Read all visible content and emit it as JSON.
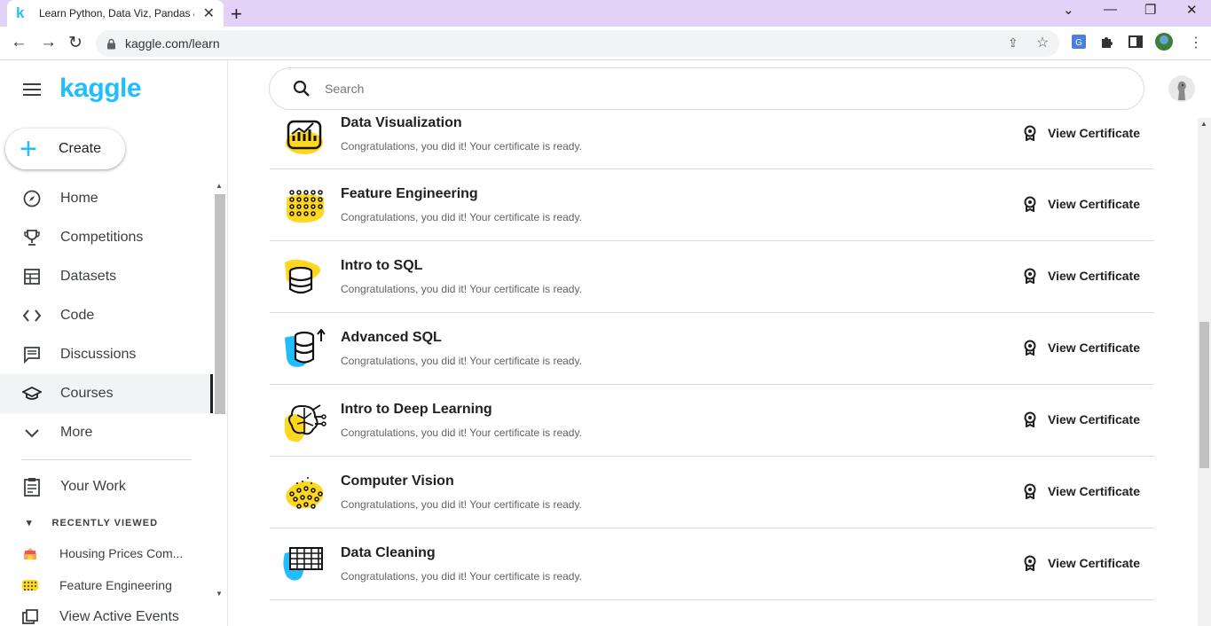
{
  "browser": {
    "tab_title": "Learn Python, Data Viz, Pandas &",
    "tab_favicon": "k",
    "url": "kaggle.com/learn"
  },
  "sidebar": {
    "logo": "kaggle",
    "create_label": "Create",
    "items": [
      {
        "label": "Home",
        "icon": "compass-icon"
      },
      {
        "label": "Competitions",
        "icon": "trophy-icon"
      },
      {
        "label": "Datasets",
        "icon": "table-icon"
      },
      {
        "label": "Code",
        "icon": "code-icon"
      },
      {
        "label": "Discussions",
        "icon": "comments-icon"
      },
      {
        "label": "Courses",
        "icon": "school-icon"
      },
      {
        "label": "More",
        "icon": "chevron-down-icon"
      }
    ],
    "your_work": "Your Work",
    "recently_viewed_header": "RECENTLY VIEWED",
    "recent": [
      {
        "label": "Housing Prices Com..."
      },
      {
        "label": "Feature Engineering"
      },
      {
        "label": "View Active Events"
      }
    ]
  },
  "search": {
    "placeholder": "Search"
  },
  "courses": {
    "certificate_label": "View Certificate",
    "items": [
      {
        "title": "Data Visualization",
        "message": "Congratulations, you did it! Your certificate is ready.",
        "icon": "chart-icon"
      },
      {
        "title": "Feature Engineering",
        "message": "Congratulations, you did it! Your certificate is ready.",
        "icon": "dots-grid-icon"
      },
      {
        "title": "Intro to SQL",
        "message": "Congratulations, you did it! Your certificate is ready.",
        "icon": "database-icon"
      },
      {
        "title": "Advanced SQL",
        "message": "Congratulations, you did it! Your certificate is ready.",
        "icon": "database-arrow-icon"
      },
      {
        "title": "Intro to Deep Learning",
        "message": "Congratulations, you did it! Your certificate is ready.",
        "icon": "brain-icon"
      },
      {
        "title": "Computer Vision",
        "message": "Congratulations, you did it! Your certificate is ready.",
        "icon": "dots-cluster-icon"
      },
      {
        "title": "Data Cleaning",
        "message": "Congratulations, you did it! Your certificate is ready.",
        "icon": "grid-icon"
      }
    ]
  },
  "colors": {
    "accent": "#20beff",
    "course_yellow": "#ffd81e",
    "course_blue": "#20beff"
  }
}
